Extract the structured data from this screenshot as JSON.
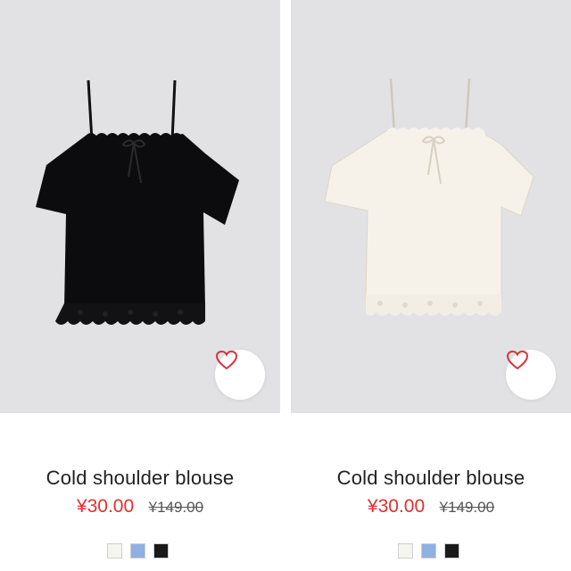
{
  "products": [
    {
      "name": "Cold shoulder blouse",
      "price": "¥30.00",
      "original_price": "¥149.00",
      "garment_color": "#0c0c0e",
      "lace_color": "#121214",
      "tie_color": "#2a2a2c",
      "swatches": [
        {
          "color": "#f5f5f0"
        },
        {
          "color": "#8eb0e3"
        },
        {
          "color": "#1a1a1a"
        }
      ]
    },
    {
      "name": "Cold shoulder blouse",
      "price": "¥30.00",
      "original_price": "¥149.00",
      "garment_color": "#f6f2ea",
      "lace_color": "#f3eee4",
      "tie_color": "#d8d0c2",
      "swatches": [
        {
          "color": "#f5f5f0"
        },
        {
          "color": "#8eb0e3"
        },
        {
          "color": "#1a1a1a"
        }
      ]
    }
  ],
  "colors": {
    "photo_background": "#e2e2e4",
    "sale_price": "#e0312f",
    "heart": "#d4363d"
  },
  "icons": {
    "wishlist": "heart-icon"
  }
}
